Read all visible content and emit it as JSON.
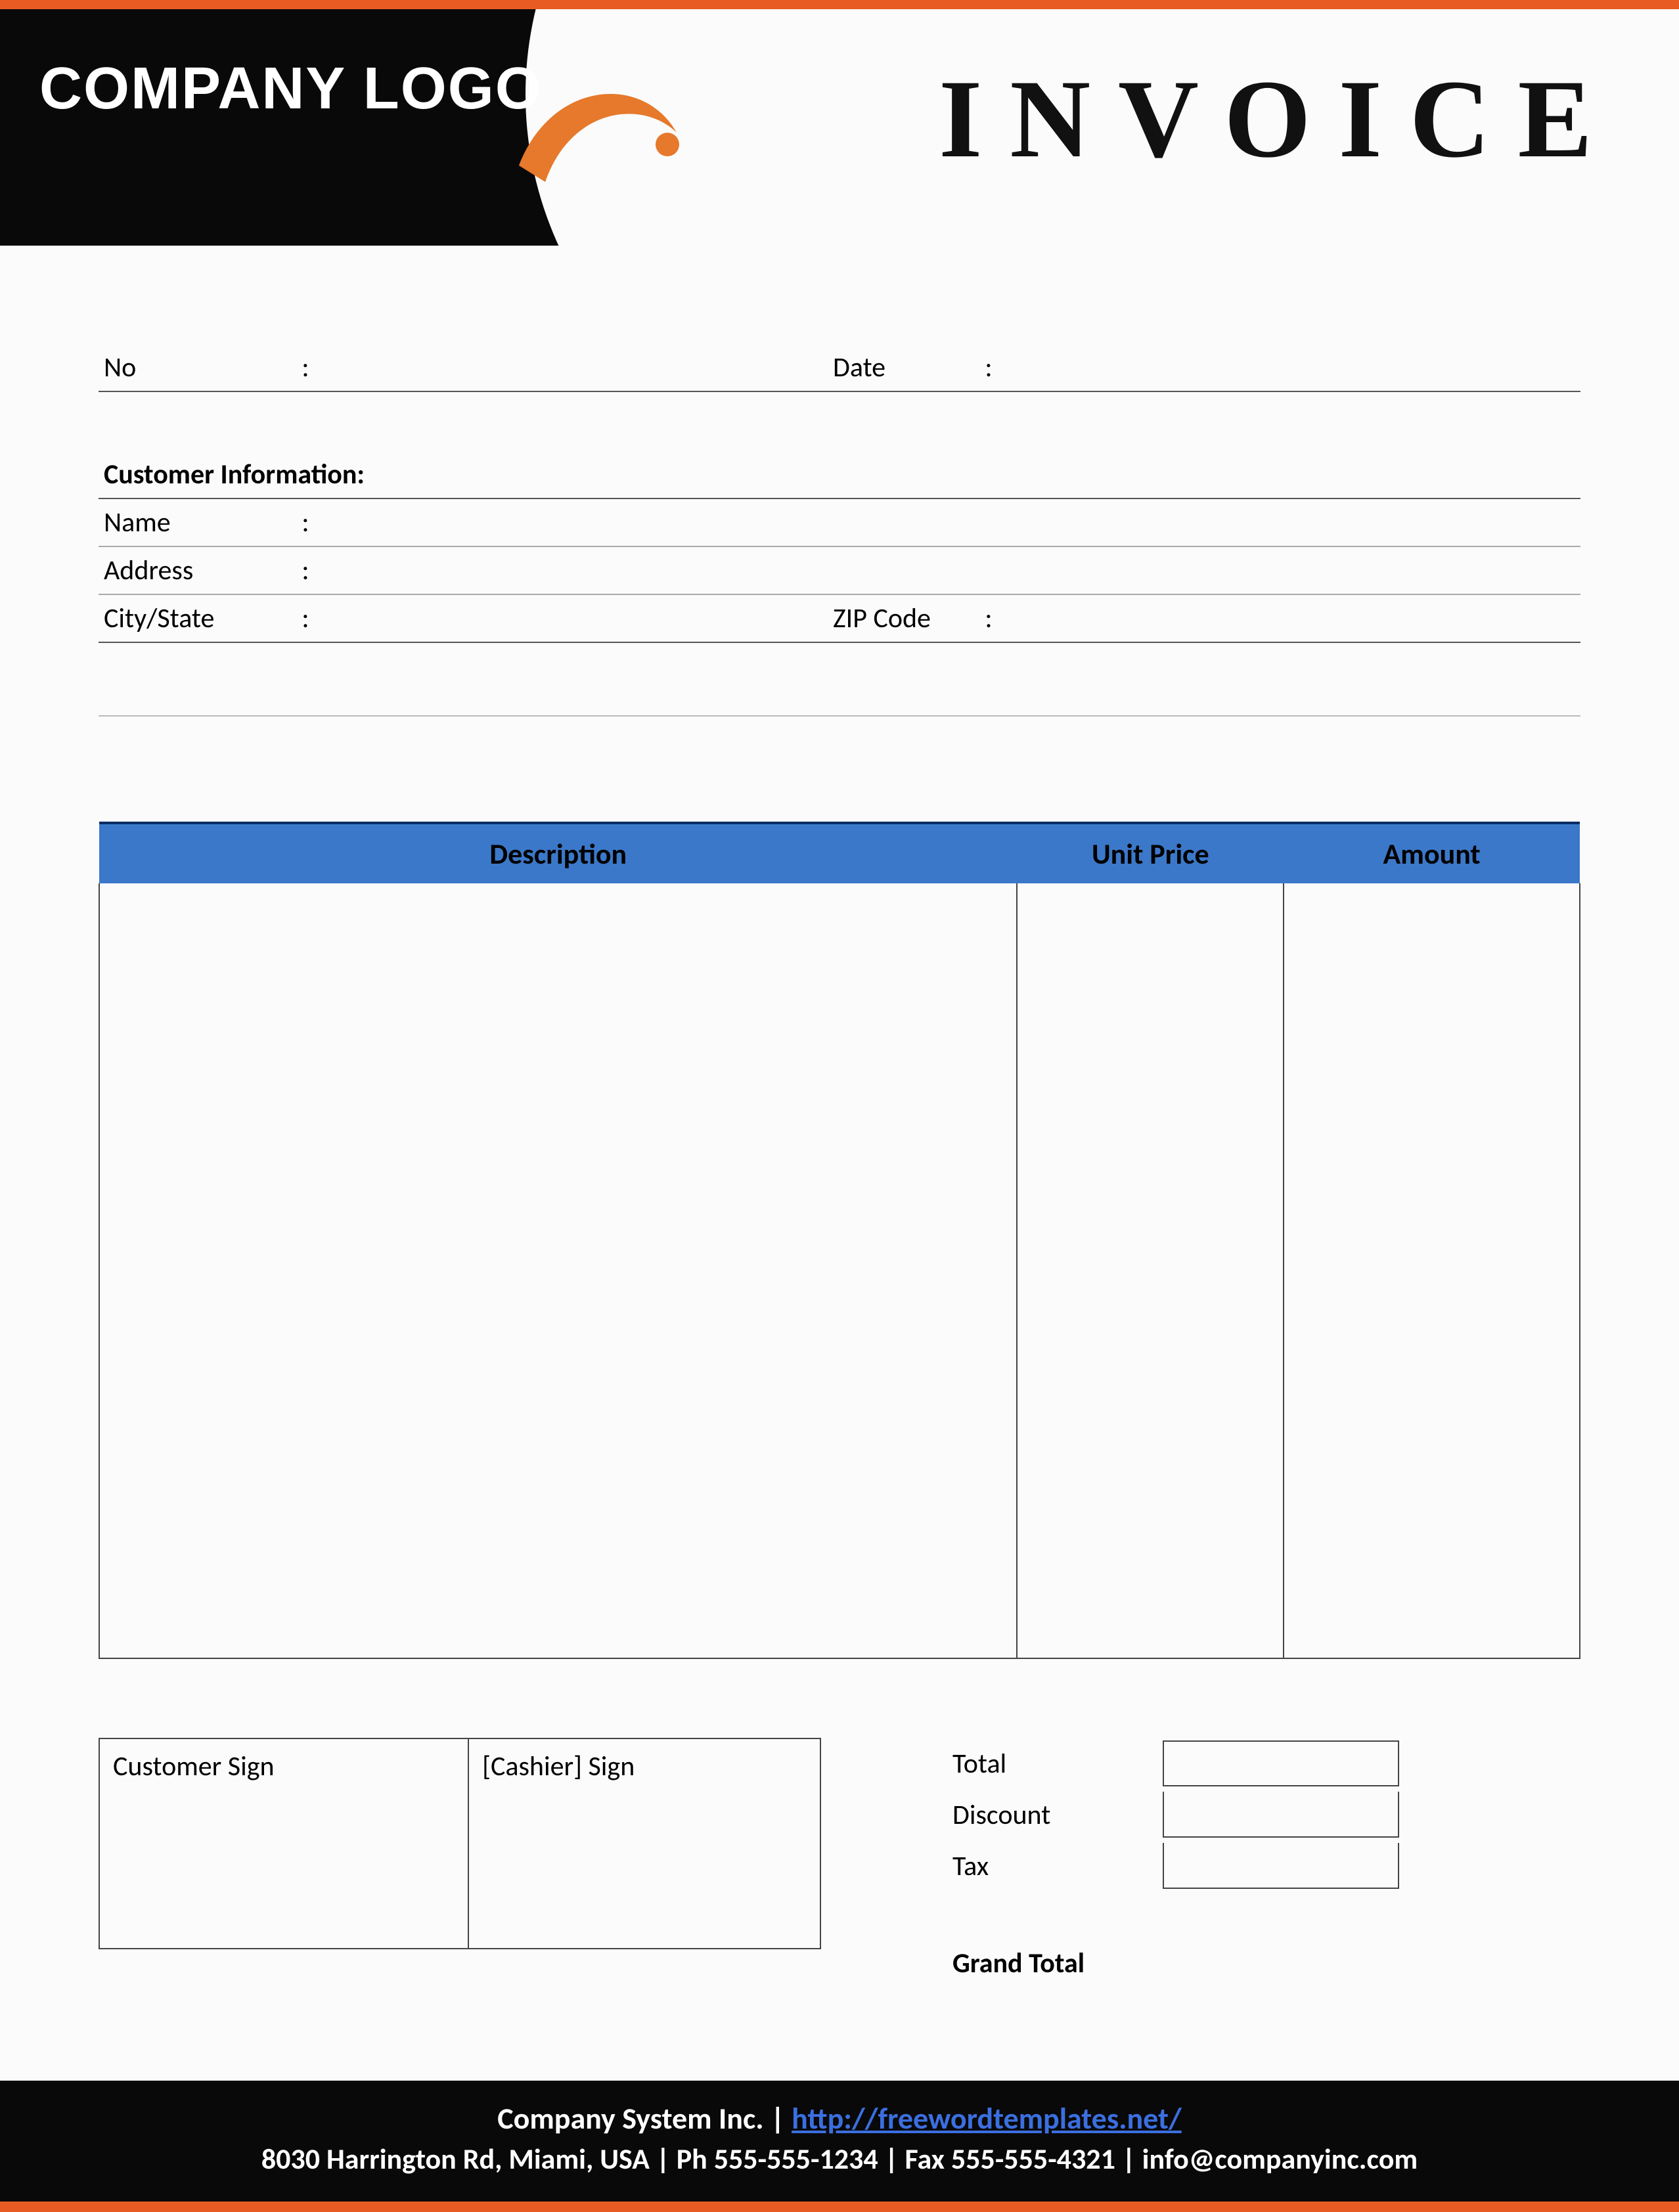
{
  "header": {
    "logo_text": "COMPANY LOGO",
    "invoice_title": "INVOICE"
  },
  "meta": {
    "no_label": "No",
    "no_value": "",
    "date_label": "Date",
    "date_value": ""
  },
  "customer_section": {
    "title": "Customer Information:",
    "name_label": "Name",
    "name_value": "",
    "address_label": "Address",
    "address_value": "",
    "citystate_label": "City/State",
    "citystate_value": "",
    "zip_label": "ZIP Code",
    "zip_value": ""
  },
  "items": {
    "headers": {
      "description": "Description",
      "unit_price": "Unit Price",
      "amount": "Amount"
    }
  },
  "signatures": {
    "customer_sign": "Customer Sign",
    "cashier_sign": "[Cashier] Sign"
  },
  "totals": {
    "total": "Total",
    "discount": "Discount",
    "tax": "Tax",
    "grand_total": "Grand Total"
  },
  "footer": {
    "company": "Company System Inc.",
    "separator": " | ",
    "url": "http://freewordtemplates.net/",
    "line2": "8030 Harrington Rd, Miami, USA | Ph 555-555-1234 | Fax 555-555-4321 | info@companyinc.com"
  },
  "separator": ":"
}
